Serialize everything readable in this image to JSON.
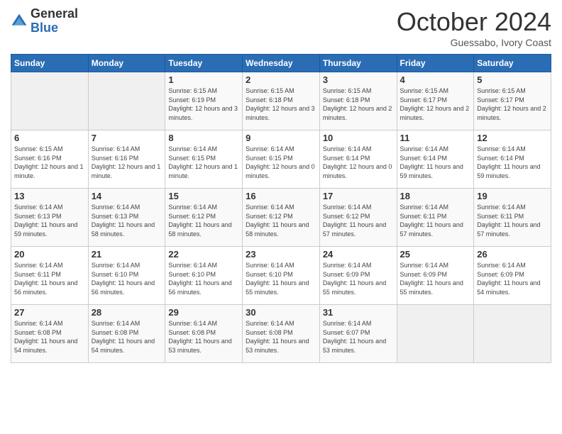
{
  "header": {
    "logo_general": "General",
    "logo_blue": "Blue",
    "month_title": "October 2024",
    "location": "Guessabo, Ivory Coast"
  },
  "days_of_week": [
    "Sunday",
    "Monday",
    "Tuesday",
    "Wednesday",
    "Thursday",
    "Friday",
    "Saturday"
  ],
  "weeks": [
    [
      {
        "day": "",
        "info": ""
      },
      {
        "day": "",
        "info": ""
      },
      {
        "day": "1",
        "info": "Sunrise: 6:15 AM\nSunset: 6:19 PM\nDaylight: 12 hours and 3 minutes."
      },
      {
        "day": "2",
        "info": "Sunrise: 6:15 AM\nSunset: 6:18 PM\nDaylight: 12 hours and 3 minutes."
      },
      {
        "day": "3",
        "info": "Sunrise: 6:15 AM\nSunset: 6:18 PM\nDaylight: 12 hours and 2 minutes."
      },
      {
        "day": "4",
        "info": "Sunrise: 6:15 AM\nSunset: 6:17 PM\nDaylight: 12 hours and 2 minutes."
      },
      {
        "day": "5",
        "info": "Sunrise: 6:15 AM\nSunset: 6:17 PM\nDaylight: 12 hours and 2 minutes."
      }
    ],
    [
      {
        "day": "6",
        "info": "Sunrise: 6:15 AM\nSunset: 6:16 PM\nDaylight: 12 hours and 1 minute."
      },
      {
        "day": "7",
        "info": "Sunrise: 6:14 AM\nSunset: 6:16 PM\nDaylight: 12 hours and 1 minute."
      },
      {
        "day": "8",
        "info": "Sunrise: 6:14 AM\nSunset: 6:15 PM\nDaylight: 12 hours and 1 minute."
      },
      {
        "day": "9",
        "info": "Sunrise: 6:14 AM\nSunset: 6:15 PM\nDaylight: 12 hours and 0 minutes."
      },
      {
        "day": "10",
        "info": "Sunrise: 6:14 AM\nSunset: 6:14 PM\nDaylight: 12 hours and 0 minutes."
      },
      {
        "day": "11",
        "info": "Sunrise: 6:14 AM\nSunset: 6:14 PM\nDaylight: 11 hours and 59 minutes."
      },
      {
        "day": "12",
        "info": "Sunrise: 6:14 AM\nSunset: 6:14 PM\nDaylight: 11 hours and 59 minutes."
      }
    ],
    [
      {
        "day": "13",
        "info": "Sunrise: 6:14 AM\nSunset: 6:13 PM\nDaylight: 11 hours and 59 minutes."
      },
      {
        "day": "14",
        "info": "Sunrise: 6:14 AM\nSunset: 6:13 PM\nDaylight: 11 hours and 58 minutes."
      },
      {
        "day": "15",
        "info": "Sunrise: 6:14 AM\nSunset: 6:12 PM\nDaylight: 11 hours and 58 minutes."
      },
      {
        "day": "16",
        "info": "Sunrise: 6:14 AM\nSunset: 6:12 PM\nDaylight: 11 hours and 58 minutes."
      },
      {
        "day": "17",
        "info": "Sunrise: 6:14 AM\nSunset: 6:12 PM\nDaylight: 11 hours and 57 minutes."
      },
      {
        "day": "18",
        "info": "Sunrise: 6:14 AM\nSunset: 6:11 PM\nDaylight: 11 hours and 57 minutes."
      },
      {
        "day": "19",
        "info": "Sunrise: 6:14 AM\nSunset: 6:11 PM\nDaylight: 11 hours and 57 minutes."
      }
    ],
    [
      {
        "day": "20",
        "info": "Sunrise: 6:14 AM\nSunset: 6:11 PM\nDaylight: 11 hours and 56 minutes."
      },
      {
        "day": "21",
        "info": "Sunrise: 6:14 AM\nSunset: 6:10 PM\nDaylight: 11 hours and 56 minutes."
      },
      {
        "day": "22",
        "info": "Sunrise: 6:14 AM\nSunset: 6:10 PM\nDaylight: 11 hours and 56 minutes."
      },
      {
        "day": "23",
        "info": "Sunrise: 6:14 AM\nSunset: 6:10 PM\nDaylight: 11 hours and 55 minutes."
      },
      {
        "day": "24",
        "info": "Sunrise: 6:14 AM\nSunset: 6:09 PM\nDaylight: 11 hours and 55 minutes."
      },
      {
        "day": "25",
        "info": "Sunrise: 6:14 AM\nSunset: 6:09 PM\nDaylight: 11 hours and 55 minutes."
      },
      {
        "day": "26",
        "info": "Sunrise: 6:14 AM\nSunset: 6:09 PM\nDaylight: 11 hours and 54 minutes."
      }
    ],
    [
      {
        "day": "27",
        "info": "Sunrise: 6:14 AM\nSunset: 6:08 PM\nDaylight: 11 hours and 54 minutes."
      },
      {
        "day": "28",
        "info": "Sunrise: 6:14 AM\nSunset: 6:08 PM\nDaylight: 11 hours and 54 minutes."
      },
      {
        "day": "29",
        "info": "Sunrise: 6:14 AM\nSunset: 6:08 PM\nDaylight: 11 hours and 53 minutes."
      },
      {
        "day": "30",
        "info": "Sunrise: 6:14 AM\nSunset: 6:08 PM\nDaylight: 11 hours and 53 minutes."
      },
      {
        "day": "31",
        "info": "Sunrise: 6:14 AM\nSunset: 6:07 PM\nDaylight: 11 hours and 53 minutes."
      },
      {
        "day": "",
        "info": ""
      },
      {
        "day": "",
        "info": ""
      }
    ]
  ]
}
